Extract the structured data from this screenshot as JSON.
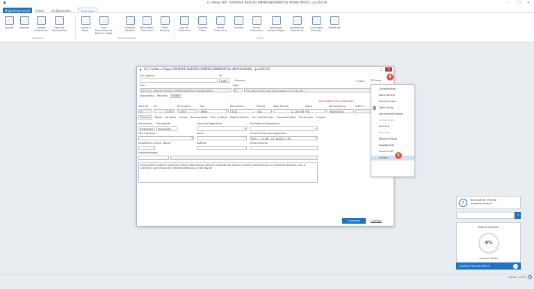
{
  "app": {
    "title": "(C) Mega ERP - [PARQUE RAPOSO EMPREENDIMENTOS IMOBILIÁRIOS - Jun/2019]",
    "tabs": [
      "Mega Empresarial",
      "Iniciar",
      "Configurações",
      "Financeiro"
    ]
  },
  "ribbon": {
    "buttons": [
      {
        "label": "Opções",
        "icon": "options-icon"
      },
      {
        "label": "Agentes",
        "icon": "agents-icon"
      },
      {
        "label": "Classes Financeiras",
        "icon": "classes-icon"
      },
      {
        "label": "Tipos de Documentos",
        "icon": "doc-types-icon"
      },
      {
        "label": "Contas a Pagar",
        "icon": "payables-icon"
      },
      {
        "label": "Gera Documento de Baixa C. Pagar",
        "icon": "gen-doc-icon"
      },
      {
        "label": "Contas a Receber",
        "icon": "receivables-icon"
      },
      {
        "label": "Movimento Financeiro",
        "icon": "movement-icon"
      },
      {
        "label": "Office Banking",
        "icon": "office-banking-icon"
      },
      {
        "label": "Log Int. Financeiro",
        "icon": "log-icon"
      },
      {
        "label": "Fluxo de Caixa",
        "icon": "cashflow-icon"
      },
      {
        "label": "Painel Financeiro",
        "icon": "panel-icon"
      },
      {
        "label": "Controle",
        "icon": "control-icon"
      },
      {
        "label": "Fecha Financeiro",
        "icon": "close-fin-icon"
      },
      {
        "label": "Aprovação Contas a Pagar",
        "icon": "approval-icon"
      },
      {
        "label": "Estatísticas Financeiras",
        "icon": "stats-icon"
      },
      {
        "label": "Conciliação Bancária",
        "icon": "reconcile-icon"
      },
      {
        "label": "Relatórios",
        "icon": "reports-icon"
      }
    ],
    "groups": [
      "Cadastros",
      "Movimentações",
      "Outros"
    ]
  },
  "dialog": {
    "title": "(C) Contas a Pagar [PARQUE RAPOSO EMPREENDIMENTOS IMOBILIÁRIOS - Jun/2019]",
    "cod_label": "Cód. Agente",
    "ap_label": "AP",
    "ap_value": "11655",
    "procurar": "Procurar",
    "inserir": "Inserir",
    "outros": "Outros",
    "filial_label": "Filial",
    "filial_value": "0007350 - PARQUE RAPOSO EMPREENDIMENTOS IMOBILIÁRIOS",
    "acao_label": "Ação",
    "acao_value": "87",
    "acao_desc": "Prev.OPAG SERV.Custo Obras Apropr.(Y/N-CTB-ORC)",
    "subtabs": [
      "Documento",
      "Parcelas",
      "Edição"
    ],
    "doc_status": "DOCUMENTO NÃO APROVADO",
    "cols": [
      "Série AP",
      "A.P.",
      "AP Original",
      "Tipo",
      "Documento",
      "Parcela",
      "Valor Parcela",
      "Índice",
      "Dt.Orçamento",
      "Saldo P"
    ],
    "row": {
      "serie": "AP",
      "ap": "11655",
      "ap_original": "11655",
      "tipo": "NFSM",
      "documento": "3122",
      "parcela": "001",
      "valor": "12.176,76",
      "indice": "R$",
      "dt_orc": "05/09/2019"
    },
    "tabs2": [
      "Cobrança",
      "Boleto",
      "Variações",
      "Classes",
      "Documentação",
      "Doct. de Baixa",
      "Pagto Eletrônico",
      "Prev. Contribuições",
      "Suspensão Pagto",
      "Escrituração",
      "Imagens"
    ],
    "venc_label": "Vencimento",
    "venc_value": "09/10/2019",
    "prorr_label": "Prorrogação",
    "prorr_value": "09/10/2019",
    "forma_label": "Forma de Pagamento",
    "prior_label": "Prioridade de Pagamento",
    "tipo_cob_label": "Tipo Cobrança",
    "banco_label": "Banco",
    "conta_prev_label": "Conta Prevista para Pagamento",
    "conta_prev_value": "8370 --- C/C BB - C/C 16454-3 - PG",
    "deposito_label": "Depósito em Conta - Banco",
    "agencia_label": "Agência",
    "conta_corrente_label": "Conta Corrente",
    "historico_label": "Histórico Padrão",
    "historico_text": "PATUSAMENTO DIRETO CONSTRUTO MFINY OBRA PARQUE RAPOSO CONDOMI NIO AZALEIA II ITEM 15 IMPLANTAÇÃO DO CANTEIRO MEDIÇÃO 1408 N CONTRATO 2497 M4200 DO CONTRATO/MEDIÇÃO 27.867.882,89",
    "confirmar": "Confirmar",
    "cancelar": "Cancelar"
  },
  "menu": {
    "items": [
      {
        "label": "Contabilidade",
        "disabled": false
      },
      {
        "label": "Nova Parcela",
        "disabled": false
      },
      {
        "label": "Exclui Parcela",
        "disabled": false
      },
      {
        "label": "Obter Ajuda",
        "disabled": false
      },
      {
        "label": "Documento original",
        "disabled": false
      },
      {
        "label": "Cancela Doc.",
        "disabled": true
      },
      {
        "label": "Parc.Ant.",
        "disabled": false
      },
      {
        "label": "Parc.Pos.",
        "disabled": true
      },
      {
        "label": "Replicar Fatura",
        "disabled": false
      },
      {
        "label": "Desaglutinar",
        "disabled": false
      },
      {
        "label": "Imprimir AP",
        "disabled": false
      },
      {
        "label": "Anexos",
        "disabled": false
      }
    ],
    "badge_top": "4",
    "badge_bottom": "5"
  },
  "sidepanel": {
    "help_text_1": "Bruno Amin, em que",
    "help_text_2": "podemos ajudar?",
    "start_title": "Você já começou",
    "percent": "0%",
    "start_sub": "da nova versão",
    "promo": "Conheça Planner 4.00.27"
  },
  "status": {
    "period": "Junho - 2019"
  },
  "colors": {
    "accent": "#1e74c4",
    "badge": "#e5533d",
    "highlight": "#cfe2f6"
  }
}
